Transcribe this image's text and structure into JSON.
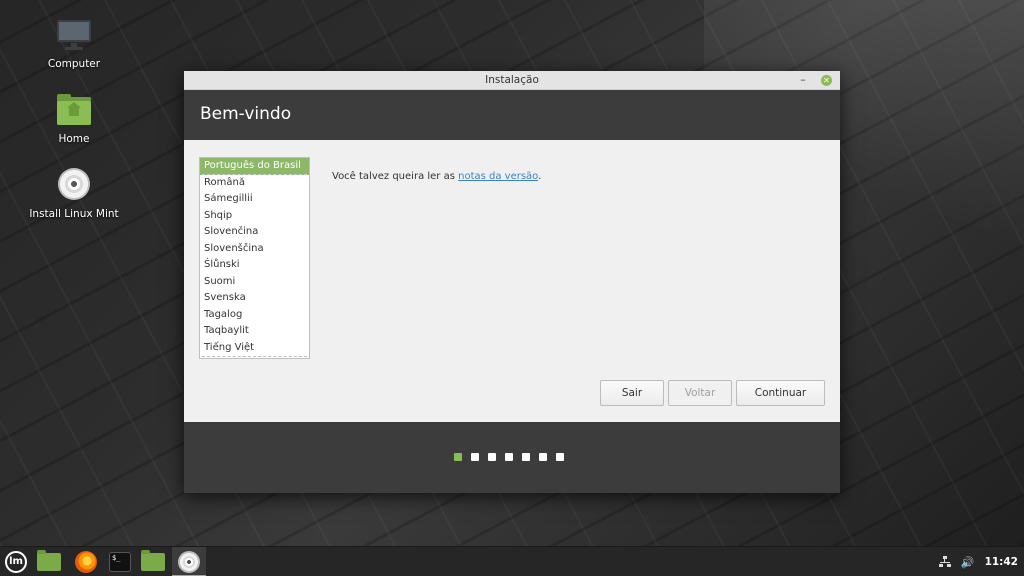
{
  "desktop": {
    "icons": [
      {
        "label": "Computer",
        "icon": "computer-icon"
      },
      {
        "label": "Home",
        "icon": "home-folder-icon"
      },
      {
        "label": "Install Linux Mint",
        "icon": "disc-icon"
      }
    ]
  },
  "window": {
    "title": "Instalação",
    "minimize_glyph": "–",
    "close_glyph": "✕",
    "header": "Bem-vindo",
    "languages": [
      "Português do Brasil",
      "Română",
      "Sámegillii",
      "Shqip",
      "Slovenčina",
      "Slovenščina",
      "Ślůnski",
      "Suomi",
      "Svenska",
      "Tagalog",
      "Taqbaylit",
      "Tiếng Việt"
    ],
    "selected_language": "Português do Brasil",
    "release_text": "Você talvez queira ler as ",
    "release_link": "notas da versão",
    "release_suffix": ".",
    "buttons": {
      "quit": "Sair",
      "back": "Voltar",
      "continue": "Continuar"
    },
    "progress": {
      "total_steps": 7,
      "current_step": 1
    }
  },
  "panel": {
    "menu_logo": "lm",
    "terminal_glyph": "$_",
    "clock": "11:42",
    "volume_glyph": "🔊",
    "accent": "#8bbd55"
  }
}
